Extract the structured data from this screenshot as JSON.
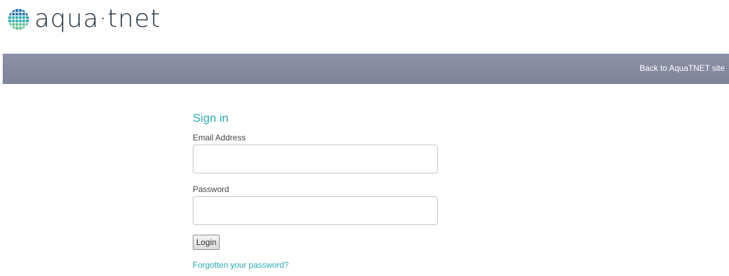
{
  "header": {
    "logo_text": "aqua·tnet",
    "logo_icon": "globe-grid-icon",
    "colors": {
      "logo_text": "#1f2f3f",
      "logo_globe": "#2aa9b0",
      "navbar": "#888ca1",
      "accent": "#2aa9b0"
    }
  },
  "nav": {
    "back_link": "Back to AquaTNET site"
  },
  "signin": {
    "title": "Sign in",
    "email_label": "Email Address",
    "email_value": "",
    "password_label": "Password",
    "password_value": "",
    "login_button": "Login",
    "forgot_link": "Forgotten your password?"
  }
}
